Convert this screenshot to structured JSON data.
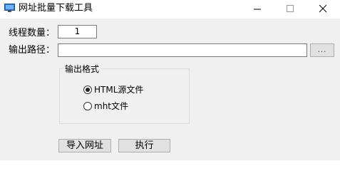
{
  "window": {
    "title": "网址批量下载工具"
  },
  "form": {
    "thread_label": "线程数量：",
    "thread_value": "1",
    "path_label": "输出路径：",
    "path_value": "",
    "browse_label": "..."
  },
  "format_group": {
    "title": "输出格式",
    "options": [
      {
        "label": "HTML源文件",
        "selected": true
      },
      {
        "label": "mht文件",
        "selected": false
      }
    ]
  },
  "actions": {
    "import_label": "导入网址",
    "run_label": "执行"
  },
  "icons": {
    "app": "monitor-icon",
    "minimize": "minimize-icon",
    "maximize": "maximize-icon",
    "close": "close-icon"
  },
  "colors": {
    "window_bg": "#f0f0f0",
    "titlebar_bg": "#ffffff",
    "button_bg": "#e1e1e1",
    "app_icon": "#2b7bd6"
  }
}
